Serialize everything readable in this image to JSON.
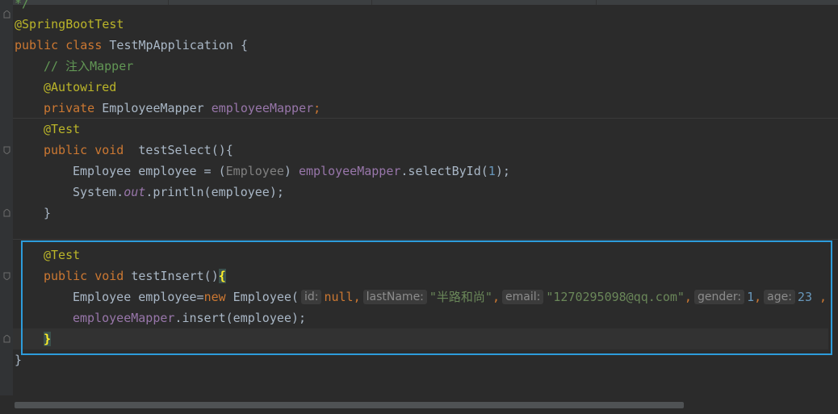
{
  "tabs": [
    "",
    "",
    ""
  ],
  "code": {
    "line0": "*/",
    "line1_annotation": "@SpringBootTest",
    "line2_kw": "public class ",
    "line2_name": "TestMpApplication {",
    "line3_comment": "// 注入Mapper",
    "line4_annotation": "@Autowired",
    "line5_kw": "private ",
    "line5_type": "EmployeeMapper ",
    "line5_field": "employeeMapper",
    "line5_semi": ";",
    "line6_annotation": "@Test",
    "line7_kw": "public void  ",
    "line7_name": "testSelect(){",
    "line8_a": "Employee employee = (",
    "line8_cast": "Employee",
    "line8_b": ") ",
    "line8_field": "employeeMapper",
    "line8_c": ".selectById(",
    "line8_num": "1",
    "line8_d": ");",
    "line9_a": "System.",
    "line9_out": "out",
    "line9_b": ".println(employee);",
    "line10": "}",
    "line12_annotation": "@Test",
    "line13_kw": "public void ",
    "line13_name": "testInsert()",
    "line13_brace": "{",
    "line14_a": "Employee employee=",
    "line14_new": "new",
    "line14_b": " Employee(",
    "line14_hint_id": "id:",
    "line14_null": "null",
    "line14_comma1": ",",
    "line14_hint_lastname": "lastName:",
    "line14_str1": "\"半路和尚\"",
    "line14_comma2": ",",
    "line14_hint_email": "email:",
    "line14_str2": "\"1270295098@qq.com\"",
    "line14_comma3": ",",
    "line14_hint_gender": "gender:",
    "line14_num1": "1",
    "line14_comma4": ",",
    "line14_hint_age": "age:",
    "line14_num2": "23",
    "line14_comma5": ",",
    "line15_field": "employeeMapper",
    "line15_b": ".insert(employee);",
    "line16_brace": "}",
    "line17": "}"
  },
  "colors": {
    "background": "#2b2b2b",
    "keyword": "#cc7832",
    "annotation": "#bbb529",
    "comment": "#629755",
    "field": "#9876aa",
    "number": "#6897bb",
    "string": "#6a8759",
    "selection_border": "#2d9cdb"
  }
}
